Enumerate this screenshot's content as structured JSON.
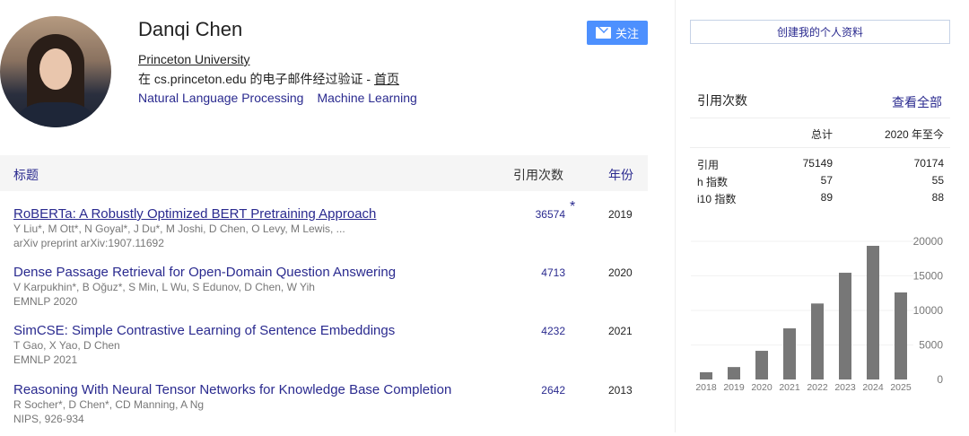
{
  "profile": {
    "name": "Danqi Chen",
    "affiliation": "Princeton University",
    "email_prefix": "在 cs.princeton.edu 的电子邮件经过验证 - ",
    "homepage": "首页",
    "interests": [
      "Natural Language Processing",
      "Machine Learning"
    ],
    "follow_label": "关注"
  },
  "table": {
    "header_title": "标题",
    "header_cites": "引用次数",
    "header_year": "年份",
    "rows": [
      {
        "title": "RoBERTa: A Robustly Optimized BERT Pretraining Approach",
        "authors": "Y Liu*, M Ott*, N Goyal*, J Du*, M Joshi, D Chen, O Levy, M Lewis, ...",
        "venue": "arXiv preprint arXiv:1907.11692",
        "cites": "36574",
        "star": "*",
        "year": "2019"
      },
      {
        "title": "Dense Passage Retrieval for Open-Domain Question Answering",
        "authors": "V Karpukhin*, B Oğuz*, S Min, L Wu, S Edunov, D Chen, W Yih",
        "venue": "EMNLP 2020",
        "cites": "4713",
        "year": "2020"
      },
      {
        "title": "SimCSE: Simple Contrastive Learning of Sentence Embeddings",
        "authors": "T Gao, X Yao, D Chen",
        "venue": "EMNLP 2021",
        "cites": "4232",
        "year": "2021"
      },
      {
        "title": "Reasoning With Neural Tensor Networks for Knowledge Base Completion",
        "authors": "R Socher*, D Chen*, CD Manning, A Ng",
        "venue": "NIPS, 926-934",
        "cites": "2642",
        "year": "2013"
      }
    ]
  },
  "sidebar": {
    "create_profile": "创建我的个人资料",
    "cited_by": "引用次数",
    "view_all": "查看全部",
    "stats": {
      "col_all": "总计",
      "col_since": "2020 年至今",
      "rows": [
        {
          "label": "引用",
          "all": "75149",
          "since": "70174"
        },
        {
          "label": "h 指数",
          "all": "57",
          "since": "55"
        },
        {
          "label": "i10 指数",
          "all": "89",
          "since": "88"
        }
      ]
    }
  },
  "chart_data": {
    "type": "bar",
    "categories": [
      "2018",
      "2019",
      "2020",
      "2021",
      "2022",
      "2023",
      "2024",
      "2025"
    ],
    "values": [
      1050,
      1800,
      4150,
      7400,
      11000,
      15450,
      19350,
      12600
    ],
    "ylim": [
      0,
      20000
    ],
    "yticks": [
      "20000",
      "15000",
      "10000",
      "5000",
      "0"
    ],
    "ytick_values": [
      20000,
      15000,
      10000,
      5000,
      0
    ],
    "color": "#777777"
  }
}
